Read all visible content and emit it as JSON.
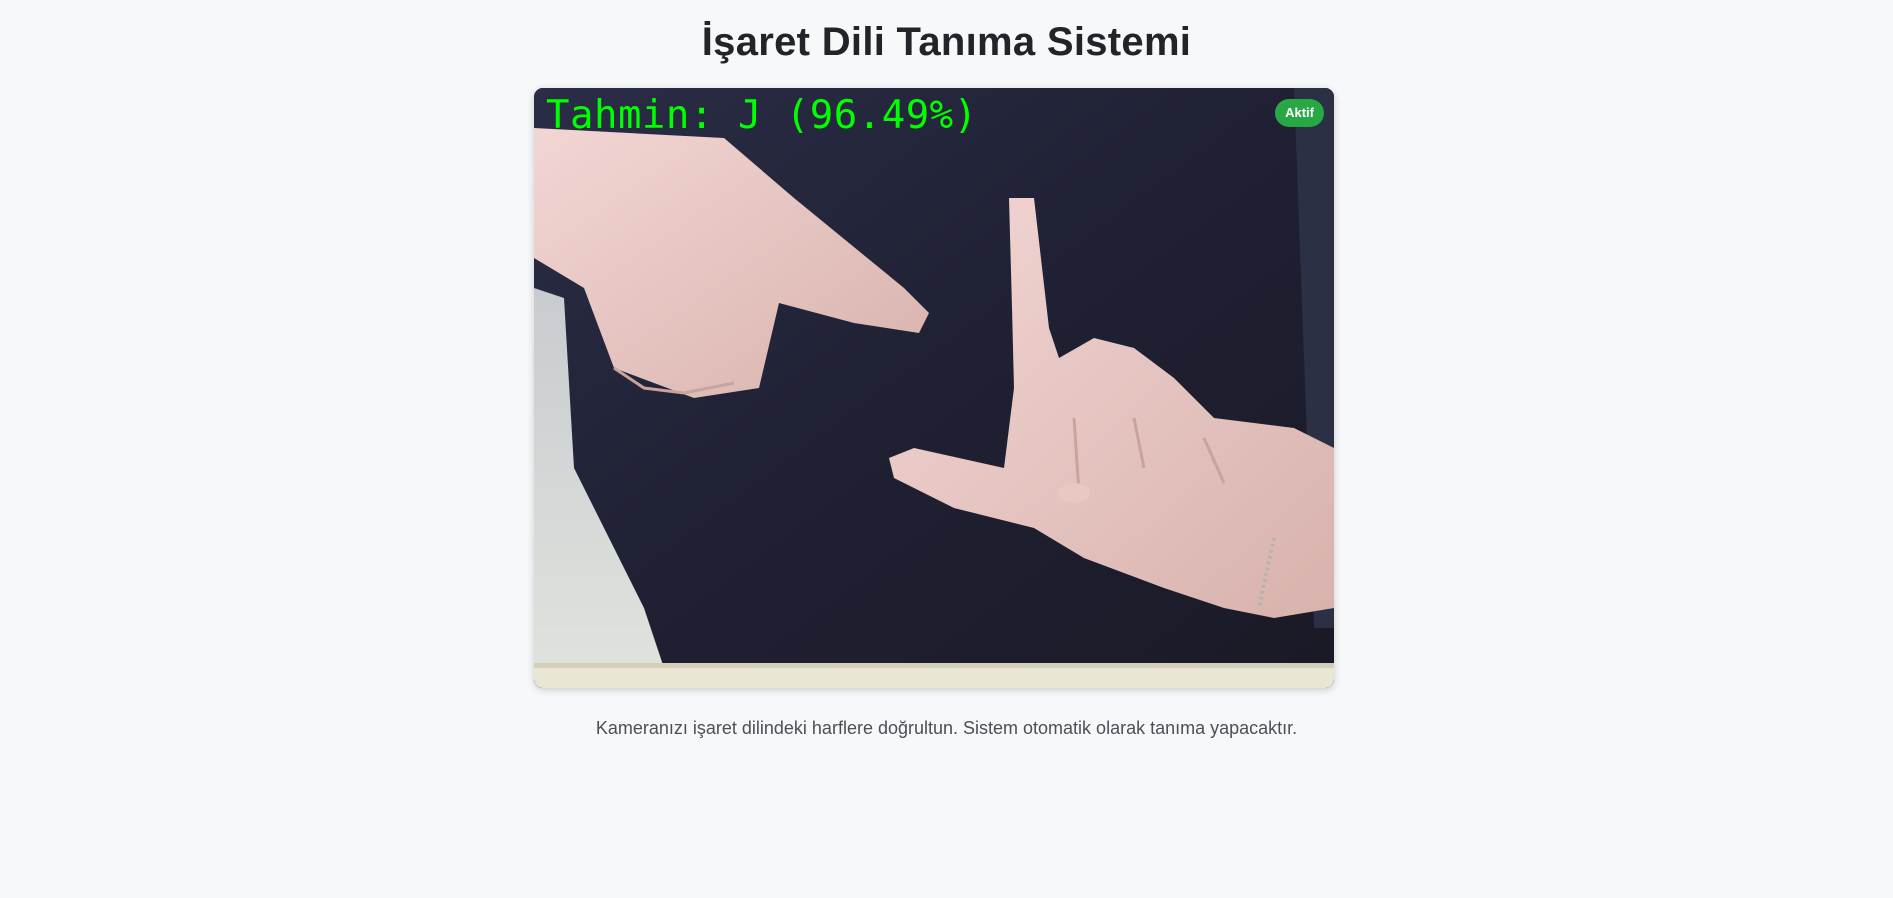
{
  "page": {
    "title": "İşaret Dili Tanıma Sistemi",
    "instructions": "Kameranızı işaret dilindeki harflere doğrultun. Sistem otomatik olarak tanıma yapacaktır."
  },
  "video": {
    "prediction_text": "Tahmin: J (96.49%)",
    "status_badge": "Aktif",
    "overlay_color": "#00ff00",
    "badge_color": "#28a745"
  }
}
